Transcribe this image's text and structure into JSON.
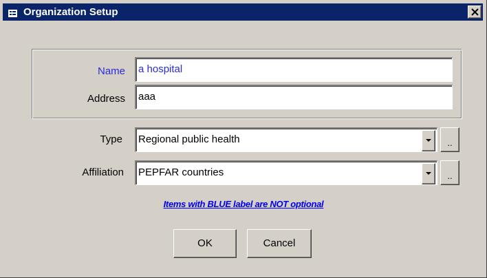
{
  "window": {
    "title": "Organization Setup",
    "icon": "form-icon",
    "close_icon": "close-icon"
  },
  "form": {
    "name": {
      "label": "Name",
      "value": "a hospital",
      "required": true
    },
    "address": {
      "label": "Address",
      "value": "aaa",
      "required": false
    },
    "type": {
      "label": "Type",
      "value": "Regional public health",
      "browse_label": ".."
    },
    "affiliation": {
      "label": "Affiliation",
      "value": "PEPFAR countries",
      "browse_label": ".."
    }
  },
  "note": "Items with BLUE label are NOT optional",
  "buttons": {
    "ok": "OK",
    "cancel": "Cancel"
  },
  "colors": {
    "titlebar": "#0a246a",
    "required_label": "#2b2bd9",
    "face": "#d4d0c8",
    "link": "#0000ee"
  }
}
